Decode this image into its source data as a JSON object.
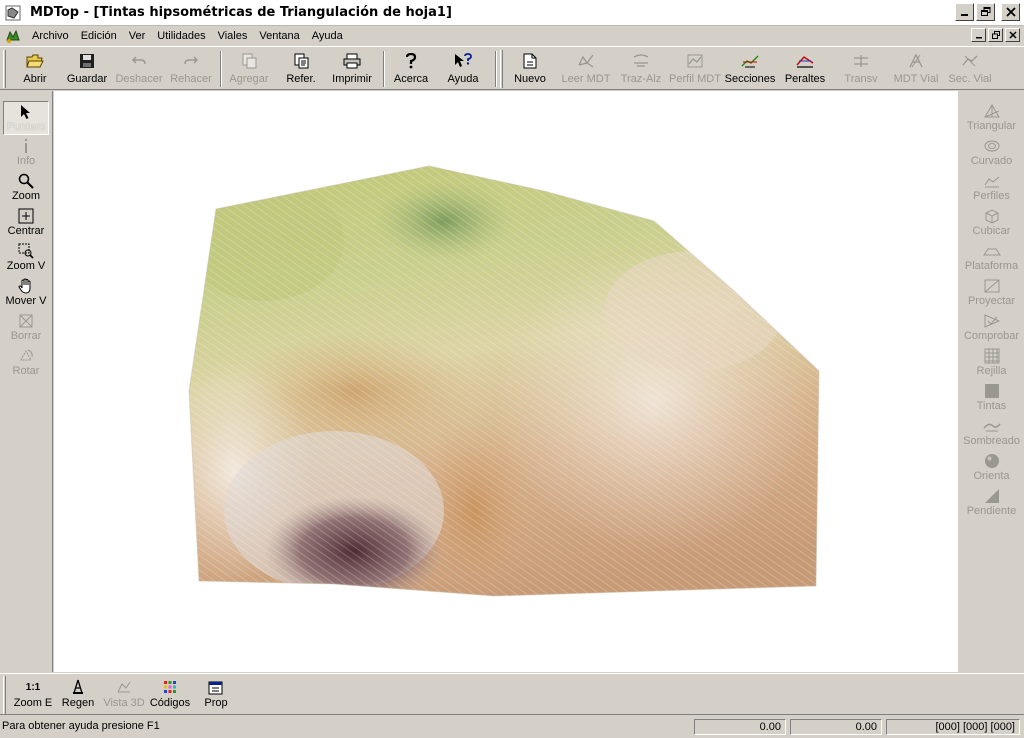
{
  "window": {
    "title": "MDTop - [Tintas hipsométricas de Triangulación de hoja1]",
    "app_icon": "mdtop-app-icon"
  },
  "menu": {
    "items": [
      "Archivo",
      "Edición",
      "Ver",
      "Utilidades",
      "Viales",
      "Ventana",
      "Ayuda"
    ]
  },
  "toolbar": {
    "items": [
      {
        "label": "Abrir",
        "icon": "open-folder-icon",
        "enabled": true
      },
      {
        "label": "Guardar",
        "icon": "save-disk-icon",
        "enabled": true
      },
      {
        "label": "Deshacer",
        "icon": "undo-icon",
        "enabled": false
      },
      {
        "label": "Rehacer",
        "icon": "redo-icon",
        "enabled": false
      },
      {
        "label": "Agregar",
        "icon": "add-document-icon",
        "enabled": false
      },
      {
        "label": "Refer.",
        "icon": "reference-icon",
        "enabled": true
      },
      {
        "label": "Imprimir",
        "icon": "printer-icon",
        "enabled": true
      },
      {
        "label": "Acerca",
        "icon": "about-question-icon",
        "enabled": true
      },
      {
        "label": "Ayuda",
        "icon": "context-help-icon",
        "enabled": true
      },
      {
        "label": "Nuevo",
        "icon": "new-document-icon",
        "enabled": true
      },
      {
        "label": "Leer MDT",
        "icon": "read-mdt-icon",
        "enabled": false
      },
      {
        "label": "Traz-Alz",
        "icon": "trace-elevation-icon",
        "enabled": false
      },
      {
        "label": "Perfil MDT",
        "icon": "profile-mdt-icon",
        "enabled": false
      },
      {
        "label": "Secciones",
        "icon": "sections-icon",
        "enabled": true
      },
      {
        "label": "Peraltes",
        "icon": "superelevation-icon",
        "enabled": true
      },
      {
        "label": "Transv",
        "icon": "transversal-icon",
        "enabled": false
      },
      {
        "label": "MDT Vial",
        "icon": "mdt-road-icon",
        "enabled": false
      },
      {
        "label": "Sec. Vial",
        "icon": "road-section-icon",
        "enabled": false
      }
    ]
  },
  "left_tools": [
    {
      "label": "Puntero",
      "icon": "pointer-arrow-icon",
      "state": "active"
    },
    {
      "label": "Info",
      "icon": "info-icon",
      "state": "disabled"
    },
    {
      "label": "Zoom",
      "icon": "magnifier-icon",
      "state": "enabled"
    },
    {
      "label": "Centrar",
      "icon": "center-crosshair-icon",
      "state": "enabled"
    },
    {
      "label": "Zoom V",
      "icon": "zoom-window-icon",
      "state": "enabled"
    },
    {
      "label": "Mover V",
      "icon": "pan-hand-icon",
      "state": "enabled"
    },
    {
      "label": "Borrar",
      "icon": "erase-icon",
      "state": "disabled"
    },
    {
      "label": "Rotar",
      "icon": "rotate-icon",
      "state": "disabled"
    }
  ],
  "right_tools": [
    {
      "label": "Triangular",
      "icon": "triangulate-icon"
    },
    {
      "label": "Curvado",
      "icon": "contour-icon"
    },
    {
      "label": "Perfiles",
      "icon": "profiles-icon"
    },
    {
      "label": "Cubicar",
      "icon": "volume-cube-icon"
    },
    {
      "label": "Plataforma",
      "icon": "platform-icon"
    },
    {
      "label": "Proyectar",
      "icon": "project-icon"
    },
    {
      "label": "Comprobar",
      "icon": "check-icon"
    },
    {
      "label": "Rejilla",
      "icon": "grid-icon"
    },
    {
      "label": "Tintas",
      "icon": "tints-square-icon"
    },
    {
      "label": "Sombreado",
      "icon": "shading-icon"
    },
    {
      "label": "Orienta",
      "icon": "orientation-sphere-icon"
    },
    {
      "label": "Pendiente",
      "icon": "slope-triangle-icon"
    }
  ],
  "bottom_tools": [
    {
      "label": "Zoom E",
      "glyph": "1:1",
      "icon": "zoom-scale-icon",
      "enabled": true
    },
    {
      "label": "Regen",
      "icon": "regen-icon",
      "enabled": true
    },
    {
      "label": "Vista 3D",
      "icon": "view-3d-icon",
      "enabled": false
    },
    {
      "label": "Códigos",
      "icon": "codes-dots-icon",
      "enabled": true
    },
    {
      "label": "Prop",
      "icon": "properties-icon",
      "enabled": true
    }
  ],
  "status": {
    "message": "Para obtener ayuda presione F1",
    "x": "0.00",
    "y": "0.00",
    "flags": "[000] [000] [000]"
  },
  "colors": {
    "chrome": "#d4d0c8",
    "canvas": "#ffffff",
    "terrain_low": "#7a9a5a",
    "terrain_mid": "#c8a070",
    "terrain_high": "#efe6dc",
    "terrain_dark": "#4a2a30"
  }
}
